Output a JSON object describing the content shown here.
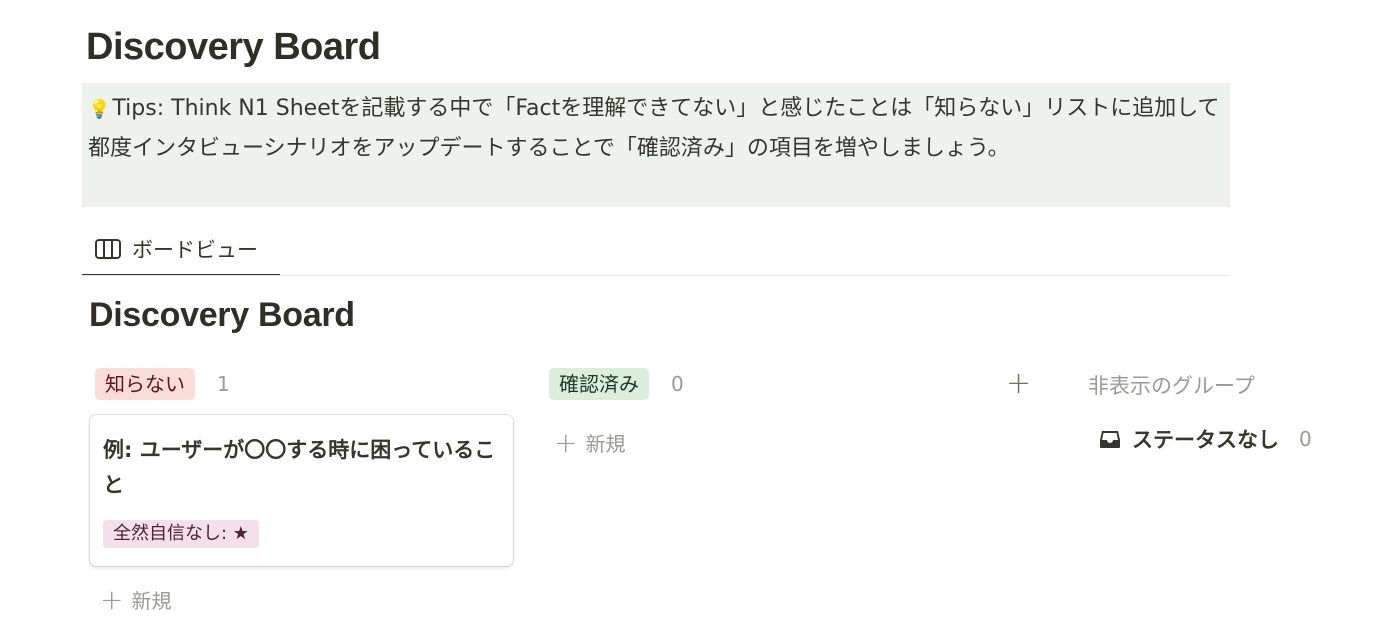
{
  "page": {
    "title": "Discovery Board"
  },
  "callout": {
    "icon": "lightbulb-icon",
    "emoji": "💡",
    "text": "Tips: Think N1 Sheetを記載する中で「Factを理解できてない」と感じたことは「知らない」リストに追加して都度インタビューシナリオをアップデートすることで「確認済み」の項目を増やしましょう。",
    "background": "#edf3ec"
  },
  "views": [
    {
      "label": "ボードビュー",
      "icon": "board-view-icon",
      "active": true
    }
  ],
  "board": {
    "title": "Discovery Board",
    "columns": [
      {
        "label": "知らない",
        "count": "1",
        "color": "#fbdcd8",
        "cards": [
          {
            "title": "例: ユーザーが〇〇する時に困っていること",
            "tag": "全然自信なし: ★"
          }
        ],
        "new_label": "新規"
      },
      {
        "label": "確認済み",
        "count": "0",
        "color": "#dbeddb",
        "cards": [],
        "new_label": "新規"
      }
    ],
    "add_group_symbol": "+",
    "hidden_groups": {
      "title": "非表示のグループ",
      "items": [
        {
          "label": "ステータスなし",
          "count": "0",
          "icon": "inbox-icon"
        }
      ]
    }
  }
}
